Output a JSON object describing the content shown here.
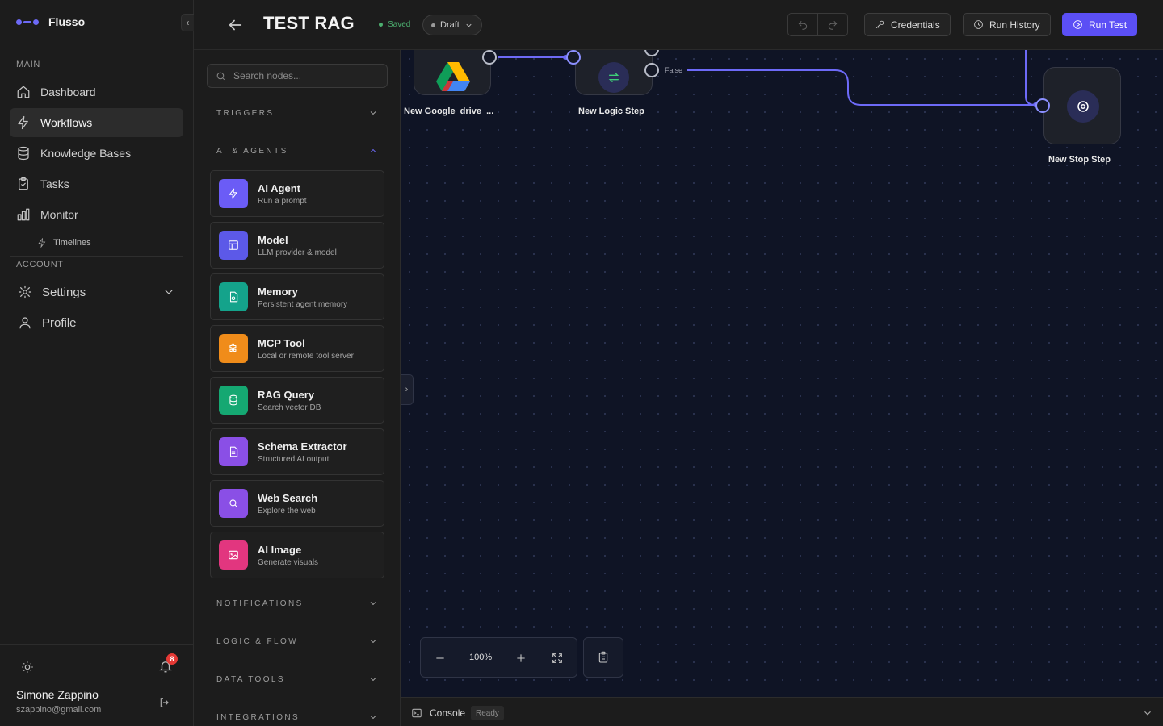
{
  "app": {
    "name": "Flusso",
    "accent": "#5b4ff5"
  },
  "sidebar": {
    "main_label": "MAIN",
    "account_label": "ACCOUNT",
    "items": [
      {
        "label": "Dashboard",
        "icon": "home-icon"
      },
      {
        "label": "Workflows",
        "icon": "bolt-icon",
        "active": true
      },
      {
        "label": "Knowledge Bases",
        "icon": "database-icon"
      },
      {
        "label": "Tasks",
        "icon": "clipboard-icon"
      },
      {
        "label": "Monitor",
        "icon": "bar-chart-icon"
      }
    ],
    "sub_items": [
      {
        "label": "Timelines",
        "icon": "bolt-icon"
      }
    ],
    "account_items": [
      {
        "label": "Settings",
        "icon": "gear-icon",
        "expandable": true
      },
      {
        "label": "Profile",
        "icon": "user-icon"
      }
    ],
    "notifications_count": "8",
    "user": {
      "name": "Simone Zappino",
      "email": "szappino@gmail.com"
    }
  },
  "topbar": {
    "title": "TEST RAG",
    "saved_label": "Saved",
    "status": "Draft",
    "credentials_label": "Credentials",
    "run_history_label": "Run History",
    "run_test_label": "Run Test"
  },
  "library": {
    "search_placeholder": "Search nodes...",
    "categories": [
      {
        "label": "TRIGGERS",
        "expanded": false
      },
      {
        "label": "AI & AGENTS",
        "expanded": true
      },
      {
        "label": "NOTIFICATIONS",
        "expanded": false
      },
      {
        "label": "LOGIC & FLOW",
        "expanded": false
      },
      {
        "label": "DATA TOOLS",
        "expanded": false
      },
      {
        "label": "INTEGRATIONS",
        "expanded": false
      }
    ],
    "nodes": [
      {
        "title": "AI Agent",
        "desc": "Run a prompt",
        "color": "#6b5cf6",
        "icon": "bolt-icon"
      },
      {
        "title": "Model",
        "desc": "LLM provider & model",
        "color": "#5c59e8",
        "icon": "layout-icon"
      },
      {
        "title": "Memory",
        "desc": "Persistent agent memory",
        "color": "#14a38b",
        "icon": "file-icon"
      },
      {
        "title": "MCP Tool",
        "desc": "Local or remote tool server",
        "color": "#f08c1a",
        "icon": "puzzle-icon"
      },
      {
        "title": "RAG Query",
        "desc": "Search vector DB",
        "color": "#15a872",
        "icon": "database-icon"
      },
      {
        "title": "Schema Extractor",
        "desc": "Structured AI output",
        "color": "#8a4fe6",
        "icon": "document-icon"
      },
      {
        "title": "Web Search",
        "desc": "Explore the web",
        "color": "#8a4fe6",
        "icon": "search-icon"
      },
      {
        "title": "AI Image",
        "desc": "Generate visuals",
        "color": "#e2367f",
        "icon": "image-icon"
      }
    ]
  },
  "canvas": {
    "nodes": [
      {
        "label": "New Google_drive_...",
        "icon": "google-drive-icon"
      },
      {
        "label": "New Logic Step",
        "icon": "swap-icon"
      },
      {
        "label": "New Stop Step",
        "icon": "stop-icon"
      }
    ],
    "branch_false_label": "False",
    "zoom": "100%"
  },
  "console": {
    "label": "Console",
    "status": "Ready"
  }
}
